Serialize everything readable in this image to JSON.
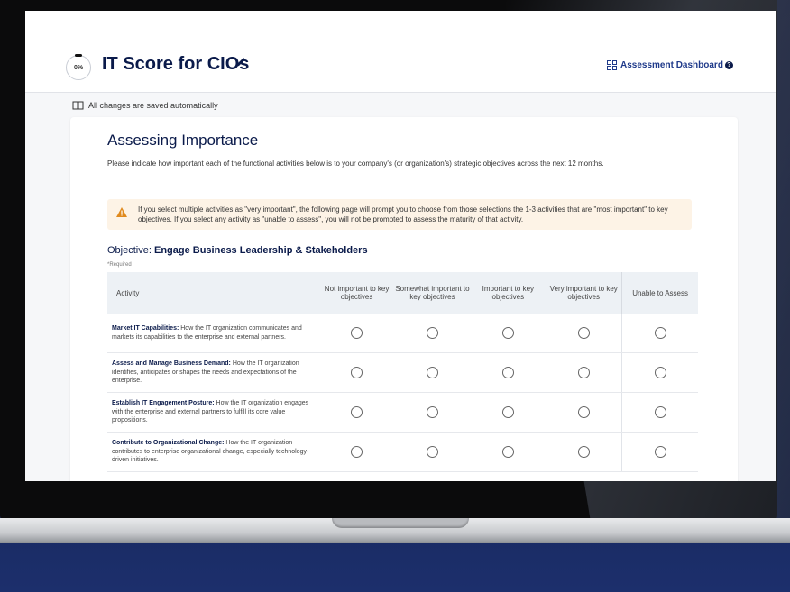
{
  "app": {
    "progress_label": "0%",
    "title": "IT Score for CIOs",
    "dashboard_link": "Assessment Dashboard",
    "save_note": "All changes are saved automatically"
  },
  "section": {
    "title": "Assessing Importance",
    "intro": "Please indicate how important each of the functional activities below is to your company's (or organization's) strategic objectives across the next 12 months.",
    "warning": "If you select multiple activities as \"very important\", the following page will prompt you to choose from those selections the 1-3 activities that are \"most important\" to key objectives. If you select any activity as \"unable to assess\", you will not be prompted to assess the maturity of that activity.",
    "objective_prefix": "Objective:",
    "objective_name": "Engage Business Leadership & Stakeholders",
    "required_note": "*Required"
  },
  "table": {
    "headers": [
      "Activity",
      "Not important to key objectives",
      "Somewhat important to key objectives",
      "Important to key objectives",
      "Very important to key objectives",
      "Unable to Assess"
    ],
    "rows": [
      {
        "name": "Market IT Capabilities:",
        "desc": "How the IT organization communicates and markets its capabilities to the enterprise and external partners."
      },
      {
        "name": "Assess and Manage Business Demand:",
        "desc": "How the IT organization identifies, anticipates or shapes the needs and expectations of the enterprise."
      },
      {
        "name": "Establish IT Engagement Posture:",
        "desc": "How the IT organization engages with the enterprise and external partners to fulfill its core value propositions."
      },
      {
        "name": "Contribute to Organizational Change:",
        "desc": "How the IT organization contributes to enterprise organizational change, especially technology-driven initiatives."
      }
    ]
  }
}
